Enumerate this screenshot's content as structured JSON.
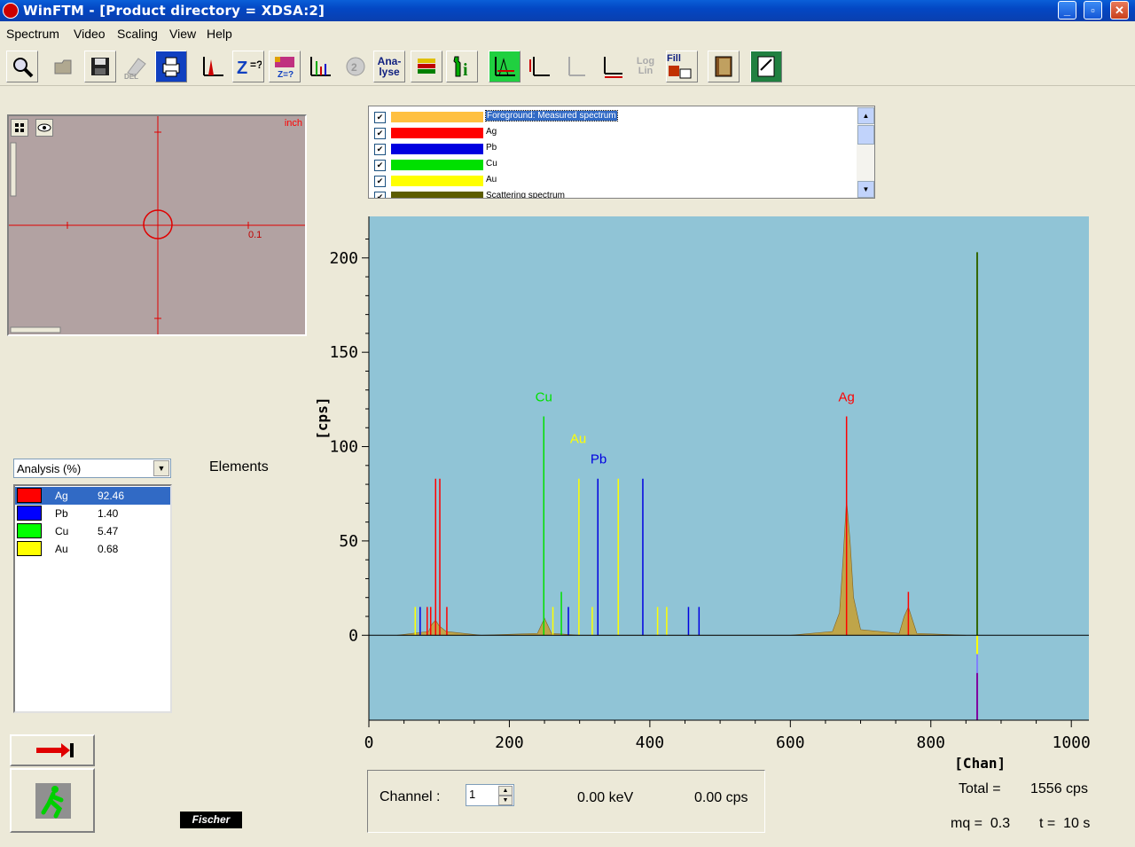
{
  "window": {
    "title": "WinFTM - [Product directory = XDSA:2]"
  },
  "menu": [
    "Spectrum",
    "Video",
    "Scaling",
    "View",
    "Help"
  ],
  "toolbar": {
    "analyse_line1": "Ana-",
    "analyse_line2": "lyse",
    "loglin_line1": "Log",
    "loglin_line2": "Lin",
    "fill": "Fill",
    "del": "DEL"
  },
  "preview": {
    "unit": "inch",
    "scale_label": "0.1"
  },
  "legend": {
    "items": [
      {
        "label": "Foreground: Measured spectrum",
        "color": "#ffc040",
        "checked": true
      },
      {
        "label": "Ag",
        "color": "#ff0000",
        "checked": true
      },
      {
        "label": "Pb",
        "color": "#0000e0",
        "checked": true
      },
      {
        "label": "Cu",
        "color": "#00e000",
        "checked": true
      },
      {
        "label": "Au",
        "color": "#ffff00",
        "checked": true
      },
      {
        "label": "Scattering spectrum",
        "color": "#5c5c00",
        "checked": true
      }
    ]
  },
  "analysis": {
    "mode": "Analysis (%)",
    "elements_label": "Elements",
    "rows": [
      {
        "element": "Ag",
        "value": "92.46",
        "color": "#ff0000"
      },
      {
        "element": "Pb",
        "value": "1.40",
        "color": "#0000ff"
      },
      {
        "element": "Cu",
        "value": "5.47",
        "color": "#00ff00"
      },
      {
        "element": "Au",
        "value": "0.68",
        "color": "#ffff00"
      }
    ]
  },
  "logo": "Fischer",
  "channel": {
    "label": "Channel :",
    "value": "1",
    "energy": "0.00 keV",
    "cps": "0.00 cps"
  },
  "totals": {
    "total_label": "Total =",
    "total_value": "1556 cps",
    "mq": "mq =  0.3",
    "time": "t =  10 s"
  },
  "chart_data": {
    "type": "line",
    "xlabel": "[Chan]",
    "ylabel": "[cps]",
    "xlim": [
      0,
      1025
    ],
    "ylim": [
      -45,
      222
    ],
    "xticks": [
      0,
      200,
      400,
      600,
      800,
      1000
    ],
    "yticks": [
      0,
      50,
      100,
      150,
      200
    ],
    "background": "#90c4d6",
    "peak_labels": [
      {
        "text": "Cu",
        "x": 249,
        "y": 124,
        "color": "#00e000"
      },
      {
        "text": "Au",
        "x": 298,
        "y": 102,
        "color": "#ffff00"
      },
      {
        "text": "Pb",
        "x": 327,
        "y": 91,
        "color": "#0000e0"
      },
      {
        "text": "Ag",
        "x": 680,
        "y": 124,
        "color": "#ff0000"
      }
    ],
    "element_lines": [
      {
        "element": "Ag",
        "color": "#ff0000",
        "x": [
          83,
          88,
          95,
          101,
          111,
          680,
          768
        ],
        "y": [
          15,
          15,
          83,
          83,
          15,
          116,
          23
        ]
      },
      {
        "element": "Pb",
        "color": "#0000e0",
        "x": [
          73,
          284,
          326,
          390,
          455,
          470
        ],
        "y": [
          15,
          15,
          83,
          83,
          15,
          15
        ]
      },
      {
        "element": "Cu",
        "color": "#00e000",
        "x": [
          249,
          274
        ],
        "y": [
          116,
          23
        ]
      },
      {
        "element": "Au",
        "color": "#ffff00",
        "x": [
          66,
          262,
          299,
          318,
          355,
          411,
          424
        ],
        "y": [
          15,
          15,
          83,
          15,
          83,
          15,
          15
        ]
      },
      {
        "element": "Scattering",
        "color": "#336600",
        "x": [
          866
        ],
        "y": [
          203
        ]
      }
    ],
    "spectrum": {
      "name": "Foreground: Measured spectrum",
      "color": "#c8a030",
      "x": [
        40,
        85,
        90,
        95,
        100,
        110,
        160,
        240,
        245,
        250,
        255,
        260,
        300,
        400,
        600,
        660,
        670,
        675,
        680,
        685,
        690,
        700,
        755,
        762,
        768,
        774,
        780,
        850
      ],
      "y": [
        0,
        2,
        6,
        8,
        5,
        2,
        0,
        1,
        5,
        9,
        5,
        1,
        0,
        0,
        0,
        2,
        12,
        40,
        72,
        50,
        20,
        3,
        1,
        10,
        15,
        8,
        1,
        0
      ]
    }
  }
}
